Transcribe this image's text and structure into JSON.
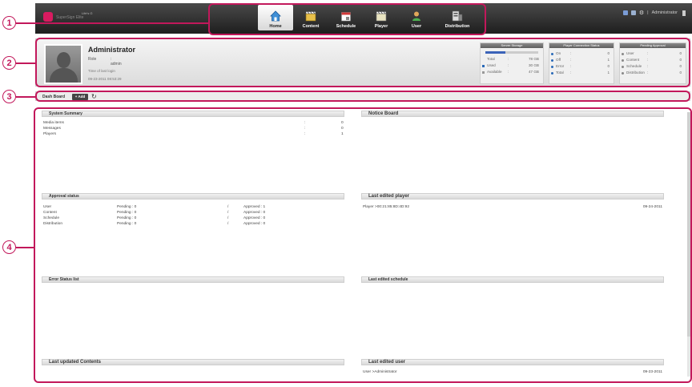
{
  "brand": {
    "small_text": "Life's G",
    "name": "SuperSign Elite"
  },
  "nav": [
    {
      "label": "Home",
      "icon": "home-icon",
      "active": true
    },
    {
      "label": "Content",
      "icon": "clapperboard-icon"
    },
    {
      "label": "Schedule",
      "icon": "calendar-icon"
    },
    {
      "label": "Player",
      "icon": "player-icon"
    },
    {
      "label": "User",
      "icon": "user-icon"
    },
    {
      "label": "Distribution",
      "icon": "distribution-icon"
    }
  ],
  "top_right": {
    "separator": "|",
    "user": "Administrator"
  },
  "profile": {
    "name": "Administrator",
    "role_label": "Role",
    "role_value": ": admin",
    "last_login_label": "Time of last login",
    "last_login_value": "09-23-2011 08:53:29"
  },
  "storage": {
    "title": "Server Storage",
    "used_fraction": 0.38,
    "rows": [
      {
        "label": "Total",
        "colon": ":",
        "value": "78 GB"
      },
      {
        "label": "Used",
        "colon": ":",
        "value": "30 GB"
      },
      {
        "label": "Available",
        "colon": ":",
        "value": "47 GB"
      }
    ]
  },
  "player_status": {
    "title": "Player Connection Status",
    "rows": [
      {
        "label": "On",
        "colon": ":",
        "value": "0"
      },
      {
        "label": "Off",
        "colon": ":",
        "value": "1"
      },
      {
        "label": "Error",
        "colon": ":",
        "value": "0"
      },
      {
        "label": "Total",
        "colon": ":",
        "value": "1"
      }
    ]
  },
  "pending_approval": {
    "title": "Pending Approval",
    "rows": [
      {
        "label": "User",
        "colon": ":",
        "value": "0"
      },
      {
        "label": "Content",
        "colon": ":",
        "value": "0"
      },
      {
        "label": "Schedule",
        "colon": ":",
        "value": "0"
      },
      {
        "label": "Distribution",
        "colon": ":",
        "value": "0"
      }
    ]
  },
  "dashboard": {
    "label": "Dash Board",
    "add_label": "+ Add",
    "refresh_icon": "refresh-icon"
  },
  "system_summary": {
    "title": "System Summary",
    "rows": [
      {
        "label": "Media items",
        "colon": ":",
        "value": "0"
      },
      {
        "label": "Messages",
        "colon": ":",
        "value": "0"
      },
      {
        "label": "Players",
        "colon": ":",
        "value": "1"
      }
    ]
  },
  "notice_board": {
    "title": "Notice Board"
  },
  "approval_status": {
    "title": "Approval status",
    "rows": [
      {
        "label": "User",
        "pending": "Pending : 0",
        "sep": "/",
        "approved": "Approved : 1"
      },
      {
        "label": "Content",
        "pending": "Pending : 0",
        "sep": "/",
        "approved": "Approved : 0"
      },
      {
        "label": "Schedule",
        "pending": "Pending : 0",
        "sep": "/",
        "approved": "Approved : 0"
      },
      {
        "label": "Distribution",
        "pending": "Pending : 0",
        "sep": "/",
        "approved": "Approved : 0"
      }
    ]
  },
  "last_edited_player": {
    "title": "Last edited player",
    "rows": [
      {
        "name": "Player >00:21:85:8D:4D:92",
        "date": "09-24-2011"
      }
    ]
  },
  "error_status": {
    "title": "Error Status list"
  },
  "last_edited_schedule": {
    "title": "Last edited schedule"
  },
  "last_updated_contents": {
    "title": "Last updated Contents"
  },
  "last_edited_user": {
    "title": "Last edited user",
    "rows": [
      {
        "name": "User >Administrator",
        "date": "09-23-2011"
      }
    ]
  },
  "callouts": [
    "1",
    "2",
    "3",
    "4"
  ],
  "colors": {
    "callout": "#c2185b",
    "topbar": "#2b2b2b",
    "accent": "#3b63b8",
    "brand": "#d81b60"
  }
}
